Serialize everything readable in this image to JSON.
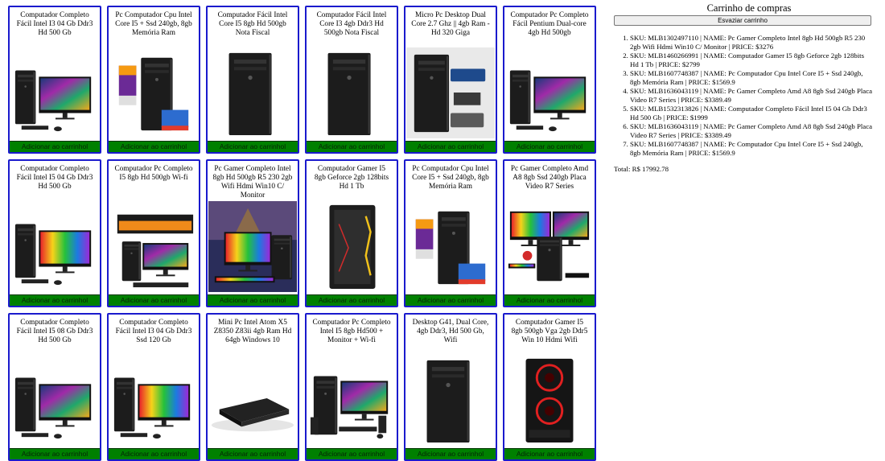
{
  "products": [
    {
      "title": "Computador Completo Fácil Intel I3 04 Gb Ddr3 Hd 500 Gb",
      "image": "tower-monitor",
      "button": "Adicionar ao carrinhol"
    },
    {
      "title": "Pc Computador Cpu Intel Core I5 + Ssd 240gb, 8gb Memória Ram",
      "image": "tower-ssd-badge",
      "button": "Adicionar ao carrinhol"
    },
    {
      "title": "Computador Fácil Intel Core I5 8gb Hd 500gb Nota Fiscal",
      "image": "tower-black",
      "button": "Adicionar ao carrinhol"
    },
    {
      "title": "Computador Fácil Intel Core I3 4gb Ddr3 Hd 500gb Nota Fiscal",
      "image": "tower-black",
      "button": "Adicionar ao carrinhol"
    },
    {
      "title": "Micro Pc Desktop Dual Core 2.7 Ghz || 4gb Ram - Hd 320 Giga",
      "image": "tower-specs",
      "button": "Adicionar ao carrinhol"
    },
    {
      "title": "Computador Pc Completo Fácil Pentium Dual-core 4gb Hd 500gb",
      "image": "tower-monitor",
      "button": "Adicionar ao carrinhol"
    },
    {
      "title": "Computador Completo Fácil Intel I5 04 Gb Ddr3 Hd 500 Gb",
      "image": "tower-monitor-rainbow",
      "button": "Adicionar ao carrinhol"
    },
    {
      "title": "Computador Pc Completo I5 8gb Hd 500gb Wi-fi",
      "image": "black-friday",
      "button": "Adicionar ao carrinhol"
    },
    {
      "title": "Pc Gamer Completo Intel 8gb Hd 500gb R5 230 2gb Wifi Hdmi Win10 C/ Monitor",
      "image": "gamer-scene",
      "button": "Adicionar ao carrinhol"
    },
    {
      "title": "Computador Gamer I5 8gb Geforce 2gb 128bits Hd 1 Tb",
      "image": "gamer-tower",
      "button": "Adicionar ao carrinhol"
    },
    {
      "title": "Pc Computador Cpu Intel Core I5 + Ssd 240gb, 8gb Memória Ram",
      "image": "tower-ssd-badge",
      "button": "Adicionar ao carrinhol"
    },
    {
      "title": "Pc Gamer Completo Amd A8 8gb Ssd 240gb Placa Video R7 Series",
      "image": "gamer-setup",
      "button": "Adicionar ao carrinhol"
    },
    {
      "title": "Computador Completo Fácil Intel I5 08 Gb Ddr3 Hd 500 Gb",
      "image": "tower-monitor",
      "button": "Adicionar ao carrinhol"
    },
    {
      "title": "Computador Completo Fácil Intel I3 04 Gb Ddr3 Ssd 120 Gb",
      "image": "tower-monitor-rainbow",
      "button": "Adicionar ao carrinhol"
    },
    {
      "title": "Mini Pc Intel Atom X5 Z8350 Z83ii 4gb Ram Hd 64gb Windows 10",
      "image": "mini-pc",
      "button": "Adicionar ao carrinhol"
    },
    {
      "title": "Computador Pc Completo Intel I5 8gb Hd500 + Monitor + Wi-fi",
      "image": "tower-peripherals",
      "button": "Adicionar ao carrinhol"
    },
    {
      "title": "Desktop G41, Dual Core, 4gb Ddr3, Hd 500 Gb, Wifi",
      "image": "tower-black",
      "button": "Adicionar ao carrinhol"
    },
    {
      "title": "Computador Gamer I5 8gb 500gb Vga 2gb Ddr5 Win 10 Hdmi Wifi",
      "image": "gamer-red-fans",
      "button": "Adicionar ao carrinhol"
    }
  ],
  "cart": {
    "title": "Carrinho de compras",
    "clear_label": "Esvaziar carrinho",
    "items": [
      "SKU: MLB1302497110 | NAME: Pc Gamer Completo Intel 8gb Hd 500gb R5 230 2gb Wifi Hdmi Win10 C/ Monitor | PRICE: $3276",
      "SKU: MLB1460266991 | NAME: Computador Gamer I5 8gb Geforce 2gb 128bits Hd 1 Tb | PRICE: $2799",
      "SKU: MLB1607748387 | NAME: Pc Computador Cpu Intel Core I5 + Ssd 240gb, 8gb Memória Ram | PRICE: $1569.9",
      "SKU: MLB1636043119 | NAME: Pc Gamer Completo Amd A8 8gb Ssd 240gb Placa Video R7 Series | PRICE: $3389.49",
      "SKU: MLB1532313826 | NAME: Computador Completo Fácil Intel I5 04 Gb Ddr3 Hd 500 Gb | PRICE: $1999",
      "SKU: MLB1636043119 | NAME: Pc Gamer Completo Amd A8 8gb Ssd 240gb Placa Video R7 Series | PRICE: $3389.49",
      "SKU: MLB1607748387 | NAME: Pc Computador Cpu Intel Core I5 + Ssd 240gb, 8gb Memória Ram | PRICE: $1569.9"
    ],
    "total": "Total: R$ 17992.78"
  },
  "colors": {
    "card_border": "#1a1acd",
    "button_bg": "#008000"
  }
}
